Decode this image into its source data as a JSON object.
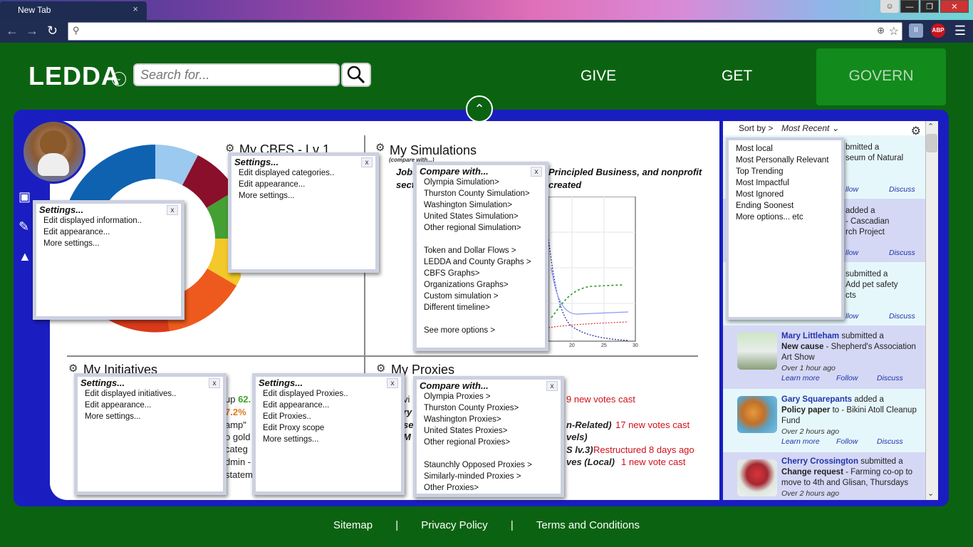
{
  "browser": {
    "tab_title": "New Tab",
    "tab_close": "×",
    "url": "",
    "ext_pause": "II",
    "ext_abp": "ABP"
  },
  "header": {
    "logo": "LEDDA",
    "search_placeholder": "Search for...",
    "nav": {
      "give": "GIVE",
      "get": "GET",
      "govern": "GOVERN"
    }
  },
  "sections": {
    "cbfs": "My CBFS - Lv 1",
    "simulations": "My Simulations",
    "sim_sub": "(compare with...)",
    "sim_text_1": "Jobs",
    "sim_text_2": "sect",
    "sim_text_3": "Principled Business, and nonprofit",
    "sim_text_4": "created",
    "initiatives": "My Initiatives",
    "proxies": "My Proxies"
  },
  "fragments": {
    "init_1a": "up ",
    "init_1b": "62.",
    "init_2": "7.2% ",
    "init_3": "amp\"",
    "init_4": "o gold",
    "init_5": "categ",
    "init_6": "dmin -",
    "init_7": "statem",
    "prox_1a": "vi",
    "prox_1b": "9 new votes cast",
    "prox_2": "ry",
    "prox_3": "se",
    "prox_4a": "M",
    "prox_4b": "n-Related)",
    "prox_4c": "17 new votes cast",
    "prox_5": "vels)",
    "prox_6a": "S lv.3)",
    "prox_6b": "Restructured 8 days ago",
    "prox_7a": "ves (Local)",
    "prox_7b": "1 new vote cast"
  },
  "popups": {
    "info_settings": {
      "title": "Settings...",
      "items": [
        "Edit displayed information..",
        "Edit appearance...",
        "More settings..."
      ]
    },
    "cbfs_settings": {
      "title": "Settings...",
      "items": [
        "Edit displayed categories..",
        "Edit appearance...",
        "More settings..."
      ]
    },
    "sim_compare": {
      "title": "Compare with...",
      "group1": [
        "Olympia Simulation>",
        "Thurston County Simulation>",
        "Washington Simulation>",
        "United States Simulation>",
        "Other regional Simulation>"
      ],
      "group2": [
        "Token and Dollar Flows >",
        "LEDDA and County Graphs >",
        "CBFS Graphs>",
        "Organizations Graphs>",
        "Custom simulation >",
        "Different timeline>"
      ],
      "group3": [
        "See more options >"
      ]
    },
    "init_settings": {
      "title": "Settings...",
      "items": [
        "Edit displayed initiatives..",
        "Edit appearance...",
        "More settings..."
      ]
    },
    "proxy_settings": {
      "title": "Settings...",
      "items": [
        "Edit displayed Proxies..",
        "Edit appearance...",
        "Edit Proxies..",
        "Edit Proxy scope",
        "More settings..."
      ]
    },
    "proxy_compare": {
      "title": "Compare with...",
      "group1": [
        "Olympia Proxies >",
        "Thurston County Proxies>",
        "Washington Proxies>",
        "United States Proxies>",
        "Other regional Proxies>"
      ],
      "group2": [
        "Staunchly Opposed Proxies >",
        "Similarly-minded Proxies >",
        "Other Proxies>"
      ]
    },
    "close": "x"
  },
  "feed": {
    "sort_label": "Sort by >",
    "sort_value": "Most Recent",
    "sort_options": [
      "Most local",
      "Most Personally Relevant",
      "Top Trending",
      "Most Impactful",
      "Most Ignored",
      "Ending Soonest",
      "More options... etc"
    ],
    "partial_items": [
      {
        "l1": "bmitted a",
        "l2": "seum of Natural",
        "follow": "llow",
        "discuss": "Discuss"
      },
      {
        "l1": "added a",
        "l2": "- Cascadian",
        "l3": "rch Project",
        "follow": "llow",
        "discuss": "Discuss"
      },
      {
        "l1": "submitted a",
        "l2": "Add pet safety",
        "l3": "cts",
        "follow": "llow",
        "discuss": "Discuss"
      }
    ],
    "items": [
      {
        "name": "Mary Littleham",
        "action": " submitted a",
        "bold": "New cause",
        "rest": " - Shepherd's Association Art Show",
        "time": "Over 1 hour ago"
      },
      {
        "name": "Gary Squarepants",
        "action": " added a",
        "bold": "Policy paper",
        "rest": " to - Bikini Atoll Cleanup Fund",
        "time": "Over 2 hours ago"
      },
      {
        "name": "Cherry Crossington",
        "action": " submitted a",
        "bold": "Change request",
        "rest": " - Farming co-op to move to 4th and Glisan, Thursdays",
        "time": "Over 2 hours ago"
      }
    ],
    "learn_more": "Learn more",
    "follow": "Follow",
    "discuss": "Discuss"
  },
  "footer": {
    "sitemap": "Sitemap",
    "sep": "|",
    "privacy": "Privacy Policy",
    "terms": "Terms and Conditions"
  },
  "chart_ticks": [
    "20",
    "25",
    "30"
  ],
  "colors": {
    "brand_green": "#0b6311",
    "panel_blue": "#1a1ec0",
    "alert_red": "#d0101a"
  }
}
